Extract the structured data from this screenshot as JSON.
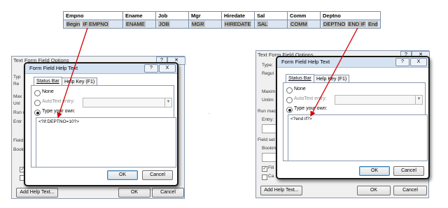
{
  "table": {
    "headers": [
      "Empno",
      "Ename",
      "Job",
      "Mgr",
      "Hiredate",
      "Sal",
      "Comm",
      "Deptno"
    ],
    "row": {
      "begin": "Begin",
      "if_empno": "IF EMPNO",
      "ename": "ENAME",
      "job": "JOB",
      "mgr": "MGR",
      "hiredate": "HIREDATE",
      "sal": "SAL",
      "comm": "COMM",
      "deptno": "DEPTNO",
      "endif": "END IF",
      "end": "End"
    }
  },
  "left": {
    "back_title": "Text Form Field Options",
    "back_labels": [
      "Typ",
      "Re",
      "Max",
      "Unl",
      "Run m",
      "Entr",
      "Field",
      "Book"
    ],
    "add_help_button": "Add Help Text...",
    "back_ok": "OK",
    "back_cancel": "Cancel",
    "dialog": {
      "title": "Form Field Help Text",
      "help_glyph": "?",
      "close_glyph": "X",
      "tab_status": "Status Bar",
      "tab_help": "Help Key (F1)",
      "opt_none": "None",
      "opt_autotext": "AutoText entry:",
      "opt_type": "Type your own:",
      "text_value": "<?if:DEPTNO=10?>",
      "ok": "OK",
      "cancel": "Cancel"
    }
  },
  "right": {
    "back_title": "Text Form Field Options",
    "back_labels": [
      "Type:",
      "Regul",
      "Maxim",
      "Unlim",
      "Run mac",
      "Entry:",
      "Field set",
      "Bookm",
      "Fill",
      "Ca"
    ],
    "add_help_button": "Add Help Text...",
    "back_ok": "OK",
    "back_cancel": "Cancel",
    "dialog": {
      "title": "Form Field Help Text",
      "help_glyph": "?",
      "close_glyph": "X",
      "tab_status": "Status Bar",
      "tab_help": "Help Key (F1)",
      "opt_none": "None",
      "opt_autotext": "AutoText entry:",
      "opt_type": "Type your own:",
      "text_value": "<?end if?>",
      "ok": "OK",
      "cancel": "Cancel"
    }
  },
  "colors": {
    "arrow": "#d40000",
    "table_row": "#dce6f2",
    "title_bar": "#d5e2f2"
  }
}
